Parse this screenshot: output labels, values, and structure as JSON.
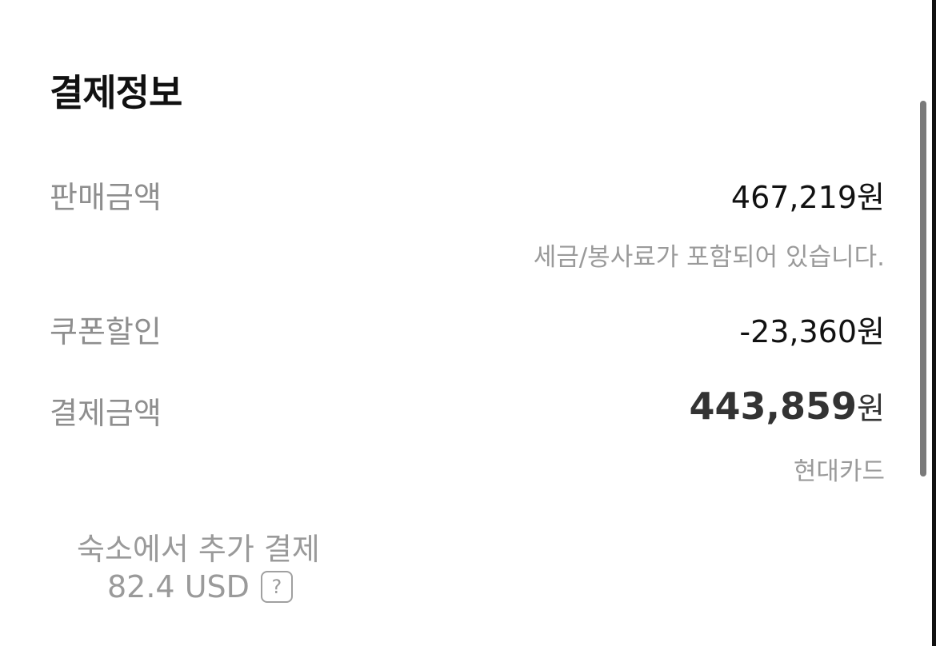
{
  "section": {
    "title": "결제정보"
  },
  "rows": {
    "sale": {
      "label": "판매금액",
      "value": "467,219원",
      "note": "세금/봉사료가 포함되어 있습니다."
    },
    "coupon": {
      "label": "쿠폰할인",
      "value": "-23,360원"
    },
    "payment": {
      "label": "결제금액",
      "amount": "443,859",
      "unit": "원",
      "method": "현대카드"
    }
  },
  "extra": {
    "label": "숙소에서 추가 결제",
    "amount": "82.4 USD",
    "help_icon": "?"
  },
  "colors": {
    "label": "#8e8e8e",
    "value": "#111111",
    "sub": "#9a9a9a"
  }
}
